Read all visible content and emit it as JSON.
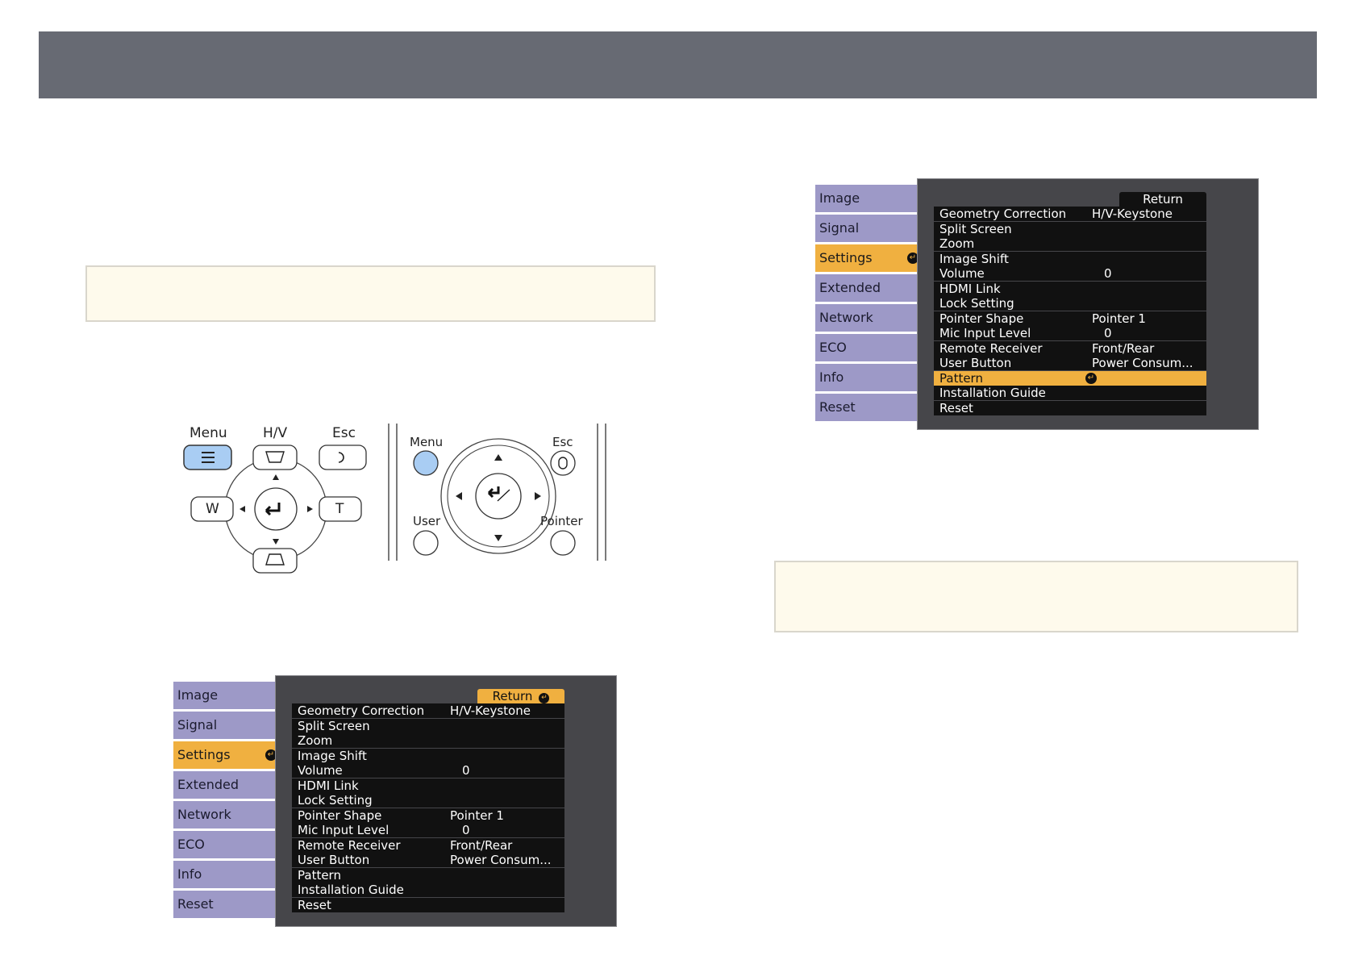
{
  "header": {},
  "remote_labels": {
    "left_menu": "Menu",
    "hv": "H/V",
    "left_esc": "Esc",
    "w": "W",
    "t": "T",
    "right_menu": "Menu",
    "right_esc": "Esc",
    "user": "User",
    "pointer": "Pointer"
  },
  "menu_top": {
    "tabs": [
      "Image",
      "Signal",
      "Settings",
      "Extended",
      "Network",
      "ECO",
      "Info",
      "Reset"
    ],
    "active_tab": "Settings",
    "return_label": "Return",
    "rows": [
      {
        "label": "Geometry Correction",
        "value": "H/V-Keystone"
      },
      {
        "label": "Split Screen",
        "value": ""
      },
      {
        "label": "Zoom",
        "value": ""
      },
      {
        "label": "Image Shift",
        "value": ""
      },
      {
        "label": "Volume",
        "value": "0"
      },
      {
        "label": "HDMI Link",
        "value": ""
      },
      {
        "label": "Lock Setting",
        "value": ""
      },
      {
        "label": "Pointer Shape",
        "value": "Pointer 1"
      },
      {
        "label": "Mic Input Level",
        "value": "0"
      },
      {
        "label": "Remote Receiver",
        "value": "Front/Rear"
      },
      {
        "label": "User Button",
        "value": "Power Consum..."
      },
      {
        "label": "Pattern",
        "value": ""
      },
      {
        "label": "Installation Guide",
        "value": ""
      },
      {
        "label": "Reset",
        "value": ""
      }
    ],
    "highlighted_row": "Pattern"
  },
  "menu_bottom": {
    "tabs": [
      "Image",
      "Signal",
      "Settings",
      "Extended",
      "Network",
      "ECO",
      "Info",
      "Reset"
    ],
    "active_tab": "Settings",
    "return_label": "Return",
    "rows": [
      {
        "label": "Geometry Correction",
        "value": "H/V-Keystone"
      },
      {
        "label": "Split Screen",
        "value": ""
      },
      {
        "label": "Zoom",
        "value": ""
      },
      {
        "label": "Image Shift",
        "value": ""
      },
      {
        "label": "Volume",
        "value": "0"
      },
      {
        "label": "HDMI Link",
        "value": ""
      },
      {
        "label": "Lock Setting",
        "value": ""
      },
      {
        "label": "Pointer Shape",
        "value": "Pointer 1"
      },
      {
        "label": "Mic Input Level",
        "value": "0"
      },
      {
        "label": "Remote Receiver",
        "value": "Front/Rear"
      },
      {
        "label": "User Button",
        "value": "Power Consum..."
      },
      {
        "label": "Pattern",
        "value": ""
      },
      {
        "label": "Installation Guide",
        "value": ""
      },
      {
        "label": "Reset",
        "value": ""
      }
    ],
    "highlighted_row": "Return"
  },
  "colors": {
    "header": "#676a73",
    "note_bg": "#fefaec",
    "tab": "#9d99c7",
    "highlight": "#f0b040",
    "panel": "#46464a",
    "remote_button_highlight": "#a9cdf3"
  }
}
